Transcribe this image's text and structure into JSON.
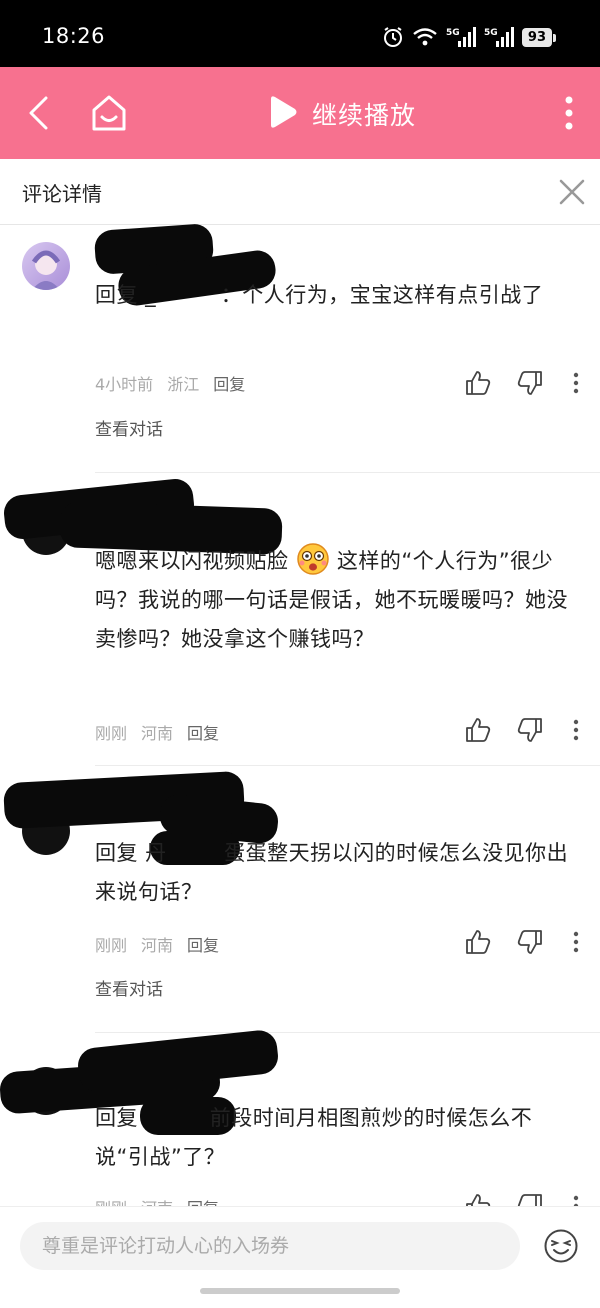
{
  "status_bar": {
    "time": "18:26",
    "battery": "93",
    "signal_1": "5G",
    "signal_2": "5G"
  },
  "top_bar": {
    "play_label": "继续播放",
    "accent": "#f7718f"
  },
  "header": {
    "title": "评论详情"
  },
  "comments": [
    {
      "text": "回复 _         ：个人行为，宝宝这样有点引战了",
      "time": "4小时前",
      "location": "浙江",
      "reply": "回复",
      "view_conversation": "查看对话"
    },
    {
      "text": "嗯嗯来以闪视频贴脸",
      "text_after_emoji": "这样的“个人行为”很少吗？我说的哪一句话是假话，她不玩暖暖吗？她没卖惨吗？她没拿这个赚钱吗？",
      "time": "刚刚",
      "location": "河南",
      "reply": "回复"
    },
    {
      "text": "回复 丹        蛋蛋整天拐以闪的时候怎么没见你出来说句话？",
      "time": "刚刚",
      "location": "河南",
      "reply": "回复",
      "view_conversation": "查看对话"
    },
    {
      "text": "回复          前段时间月相图煎炒的时候怎么不说“引战”了？",
      "time": "刚刚",
      "location": "河南",
      "reply": "回复"
    }
  ],
  "input": {
    "placeholder": "尊重是评论打动人心的入场券"
  },
  "icons": {
    "back": "back-arrow-icon",
    "home": "home-icon",
    "play": "play-icon",
    "more": "more-vertical-icon",
    "close": "close-icon",
    "like": "thumbs-up-icon",
    "dislike": "thumbs-down-icon",
    "emoji": "emoji-icon"
  }
}
